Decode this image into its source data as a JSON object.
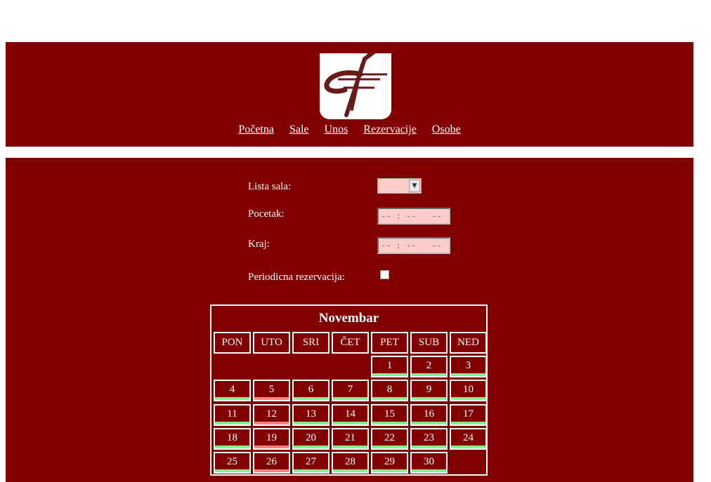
{
  "nav": {
    "items": [
      "Početna",
      "Sale",
      "Unos",
      "Rezervacije",
      "Osobe"
    ]
  },
  "form": {
    "lista_sala_label": "Lista sala:",
    "pocetak_label": "Pocetak:",
    "kraj_label": "Kraj:",
    "periodicna_label": "Periodicna rezervacija:",
    "pocetak_value": "-- : --   --",
    "kraj_value": "-- : --   --",
    "lista_sala_value": "",
    "periodicna_checked": false
  },
  "calendar": {
    "month": "Novembar",
    "weekdays": [
      "PON",
      "UTO",
      "SRI",
      "ČET",
      "PET",
      "SUB",
      "NED"
    ],
    "first_weekday_index": 4,
    "days": 30,
    "busy_days": [
      5,
      12,
      19,
      26
    ]
  },
  "colors": {
    "brand": "#800000",
    "free": "#80f090",
    "busy": "#ff8080",
    "input_bg": "#ffcccc"
  }
}
